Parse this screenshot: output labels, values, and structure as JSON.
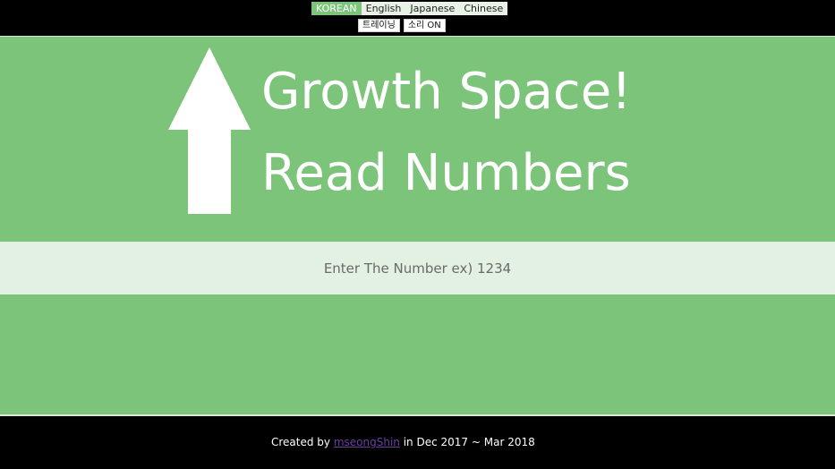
{
  "languages": [
    {
      "label": "KOREAN",
      "active": true
    },
    {
      "label": "English",
      "active": false
    },
    {
      "label": "Japanese",
      "active": false
    },
    {
      "label": "Chinese",
      "active": false
    }
  ],
  "controls": {
    "training_label": "트레이닝",
    "sound_label": "소리 ON"
  },
  "hero": {
    "icon": "up-arrow-icon",
    "title_line1": "Growth Space!",
    "title_line2": "Read Numbers"
  },
  "input": {
    "placeholder": "Enter The Number ex) 1234",
    "value": ""
  },
  "footer": {
    "prefix": "Created by ",
    "author": "mseongShin",
    "suffix": " in Dec 2017 ~ Mar 2018"
  },
  "colors": {
    "background": "#7dc47b",
    "input_band": "#e3f1e3",
    "bars": "#000000",
    "active_lang": "#7dc47b",
    "link": "#6b3fa0"
  }
}
